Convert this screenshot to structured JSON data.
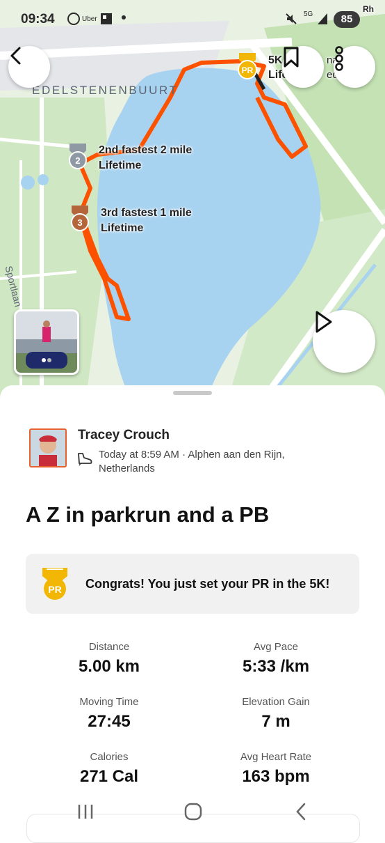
{
  "status_bar": {
    "time": "09:34",
    "apps": [
      "whatsapp-icon",
      "Uber"
    ],
    "battery": "85",
    "network": "5G"
  },
  "map": {
    "neighbourhood": "EDELSTENENBUURT",
    "street": "Sportlaan",
    "achievements": [
      {
        "medal": "PR",
        "line1": "5K",
        "line2": "Life",
        "medal_color": "#f2b705"
      },
      {
        "medal": "2",
        "line1": "2nd fastest 2 mile",
        "line2": "Lifetime",
        "medal_color": "#8e99a4"
      },
      {
        "medal": "3",
        "line1": "3rd fastest 1 mile",
        "line2": "Lifetime",
        "medal_color": "#b5653a"
      }
    ],
    "right_partial_1": "nal",
    "right_partial_2": "ed",
    "corner_partial": "Rh",
    "route_color": "#fc5200",
    "water_color": "#a8d3f0"
  },
  "activity": {
    "athlete": "Tracey Crouch",
    "meta": "Today at 8:59 AM · Alphen aan den Rijn, Netherlands",
    "title": "A Z in parkrun and a PB",
    "congrats": "Congrats! You just set your PR in the 5K!",
    "stats": [
      {
        "label": "Distance",
        "value": "5.00 km"
      },
      {
        "label": "Avg Pace",
        "value": "5:33 /km"
      },
      {
        "label": "Moving Time",
        "value": "27:45"
      },
      {
        "label": "Elevation Gain",
        "value": "7 m"
      },
      {
        "label": "Calories",
        "value": "271 Cal"
      },
      {
        "label": "Avg Heart Rate",
        "value": "163 bpm"
      }
    ]
  },
  "buttons": {
    "back": "chevron-left-icon",
    "bookmark": "bookmark-icon",
    "more": "more-vertical-icon",
    "play": "play-icon"
  }
}
